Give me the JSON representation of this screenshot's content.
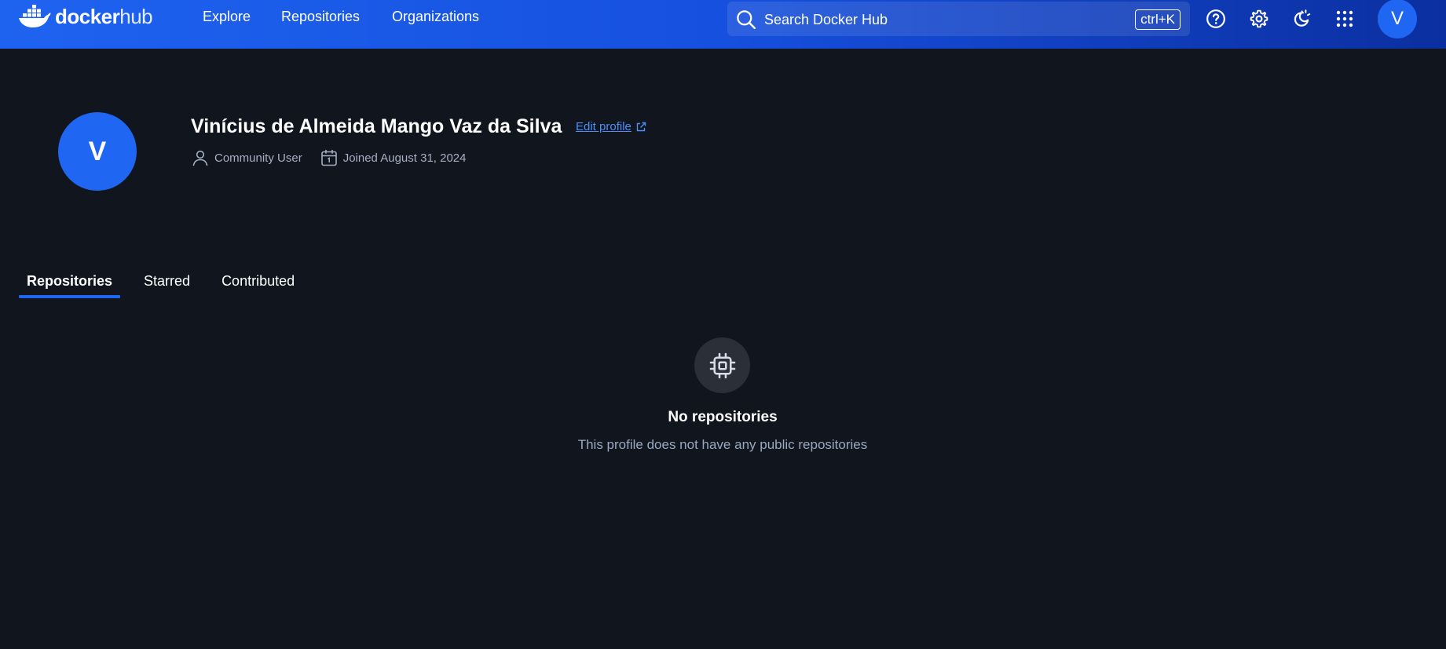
{
  "topbar": {
    "logo": {
      "word_bold": "docker",
      "word_light": "hub",
      "icon": "docker-whale-icon"
    },
    "nav": {
      "explore": "Explore",
      "repositories": "Repositories",
      "organizations": "Organizations"
    },
    "search": {
      "placeholder": "Search Docker Hub",
      "shortcut": "ctrl+K",
      "icon": "search-icon"
    },
    "icons": [
      "help-icon",
      "gear-icon",
      "theme-toggle-icon",
      "apps-grid-icon"
    ],
    "avatar_initial": "V"
  },
  "profile": {
    "avatar_initial": "V",
    "name": "Vinícius de Almeida Mango Vaz da Silva",
    "edit_link": "Edit profile",
    "user_type": "Community User",
    "joined": "Joined August 31, 2024"
  },
  "tabs": {
    "repositories": "Repositories",
    "starred": "Starred",
    "contributed": "Contributed",
    "active": "repositories"
  },
  "empty_state": {
    "icon": "chip-icon",
    "title": "No repositories",
    "message": "This profile does not have any public repositories"
  },
  "colors": {
    "background": "#10151e",
    "nav_gradient_start": "#1e63f0",
    "nav_gradient_end": "#0b2fa0",
    "accent": "#1f66f2",
    "link": "#4d8ff7",
    "muted_text": "#a5b0c2"
  }
}
